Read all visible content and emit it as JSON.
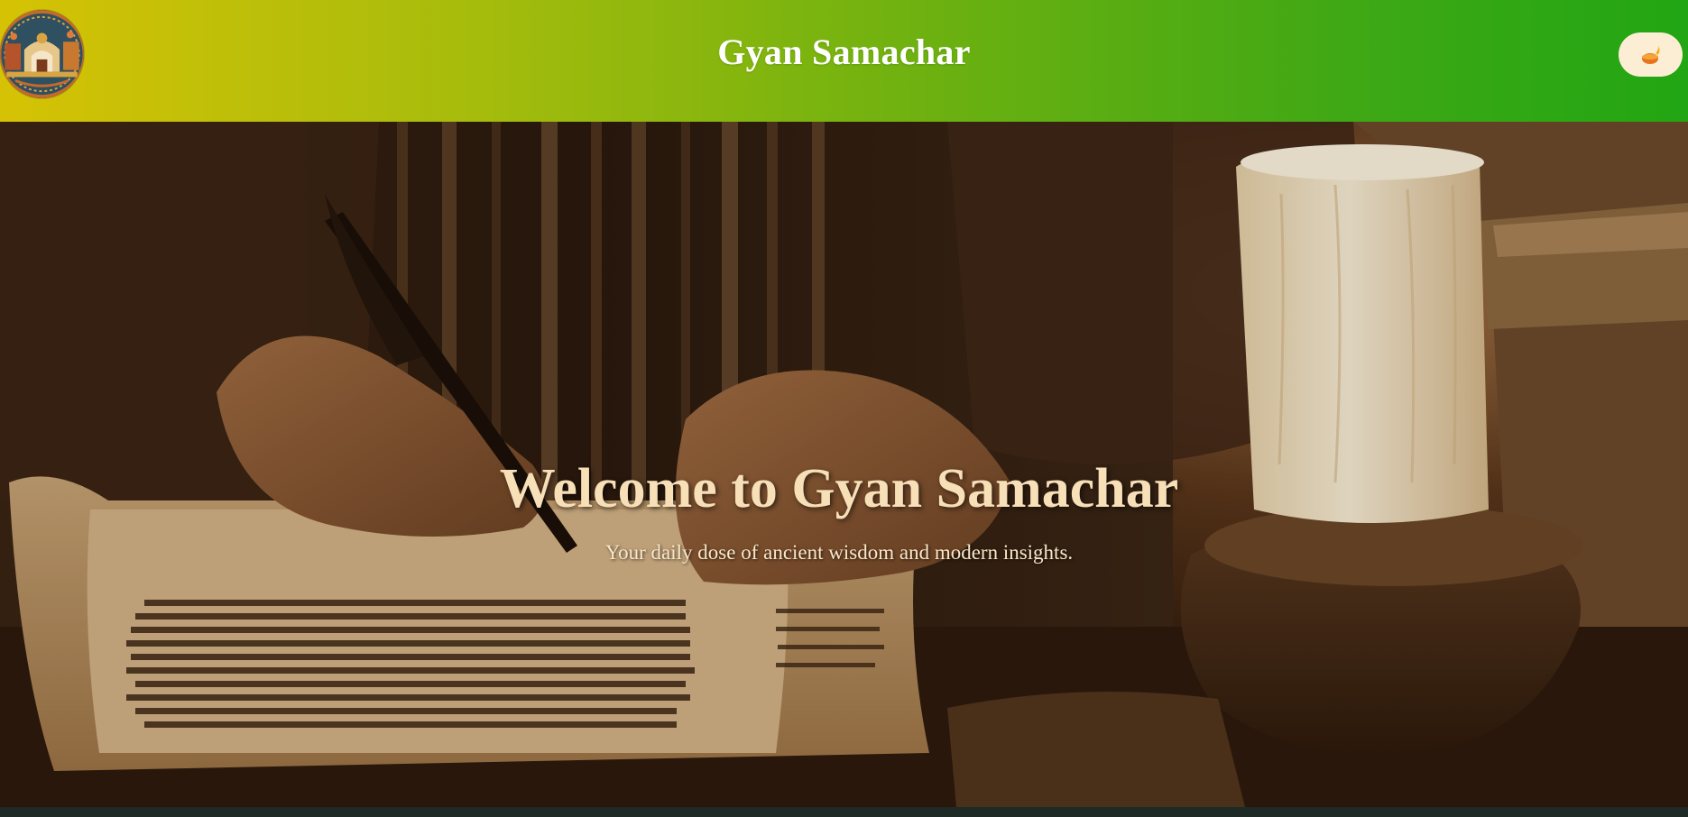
{
  "header": {
    "title": "Gyan Samachar",
    "logo_icon": "ornate-palace-logo-icon",
    "theme_toggle_icon": "diya-lamp-icon",
    "gradient_start": "#d6c205",
    "gradient_end": "#22a613"
  },
  "hero": {
    "title": "Welcome to Gyan Samachar",
    "subtitle": "Your daily dose of ancient wisdom and modern insights.",
    "image_icon": "scribe-writing-manuscript-by-candlelight-image",
    "title_color": "#f7dfb8"
  }
}
